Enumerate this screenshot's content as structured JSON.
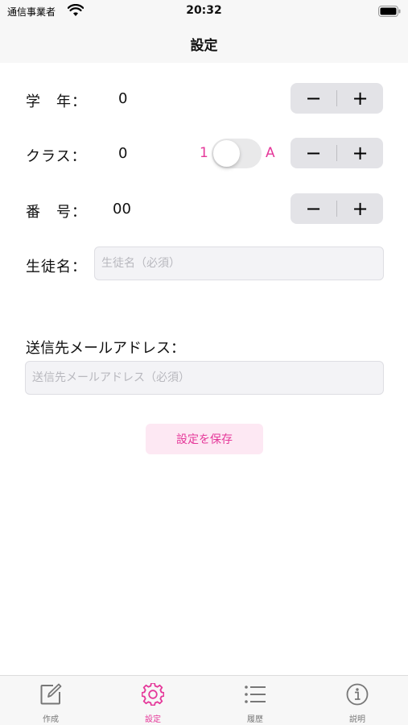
{
  "status_bar": {
    "carrier": "通信事業者",
    "time": "20:32"
  },
  "nav": {
    "title": "設定"
  },
  "form": {
    "grade": {
      "label": "学　年：",
      "value": "0"
    },
    "class": {
      "label": "クラス：",
      "value": "0",
      "toggle_left": "1",
      "toggle_right": "A",
      "toggle_on": false
    },
    "number": {
      "label": "番　号：",
      "value": "00"
    },
    "stepper": {
      "minus": "−",
      "plus": "+"
    },
    "student_name": {
      "label": "生徒名：",
      "placeholder": "生徒名（必須）",
      "value": ""
    },
    "email": {
      "label": "送信先メールアドレス：",
      "placeholder": "送信先メールアドレス（必須）",
      "value": ""
    },
    "save_label": "設定を保存"
  },
  "tabbar": {
    "items": [
      {
        "label": "作成",
        "icon": "compose-icon",
        "active": false
      },
      {
        "label": "設定",
        "icon": "gear-icon",
        "active": true
      },
      {
        "label": "履歴",
        "icon": "list-icon",
        "active": false
      },
      {
        "label": "説明",
        "icon": "info-icon",
        "active": false
      }
    ]
  },
  "colors": {
    "accent": "#e5389a",
    "stepper_bg": "#e3e3e7",
    "button_bg": "#fde8f3"
  }
}
